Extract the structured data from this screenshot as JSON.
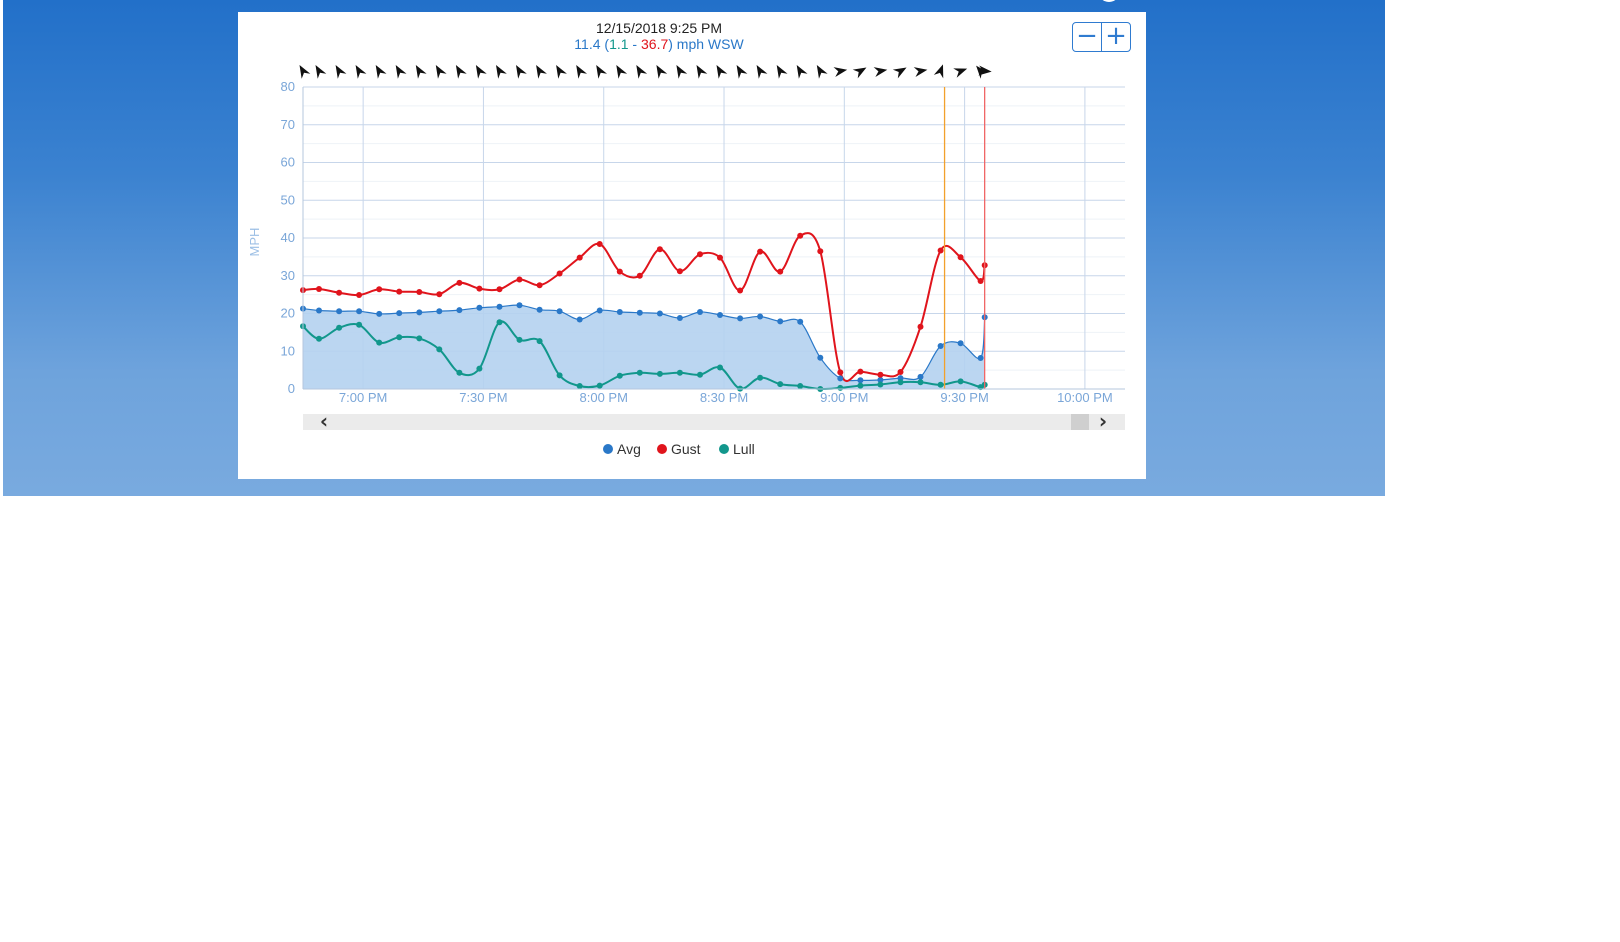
{
  "header": {
    "timestamp": "12/15/2018 9:25 PM",
    "avg_value": "11.4",
    "open_paren": " (",
    "lull_value": "1.1",
    "dash": " - ",
    "gust_value": "36.7",
    "close_unit": ") mph WSW"
  },
  "zoom": {
    "out_label": "−",
    "in_label": "+"
  },
  "colors": {
    "avg": "#2a78c8",
    "avg_fill": "#b4d1f0",
    "gust": "#e0141c",
    "lull": "#12978c",
    "grid": "#c7d6ea",
    "axis_text": "#7aa6d8",
    "cursor_line": "#f2a12c",
    "end_line": "#f06666"
  },
  "scrollbar": {
    "left_label": "‹",
    "right_label": "›"
  },
  "chart_data": {
    "type": "line",
    "ylabel": "MPH",
    "ylim": [
      0,
      80
    ],
    "yticks": [
      0,
      10,
      20,
      30,
      40,
      50,
      60,
      70,
      80
    ],
    "xlim": [
      "6:45 PM",
      "10:10 PM"
    ],
    "xticks": [
      "7:00 PM",
      "7:30 PM",
      "8:00 PM",
      "8:30 PM",
      "9:00 PM",
      "9:30 PM",
      "10:00 PM"
    ],
    "cursor_time": "9:25 PM",
    "end_time": "9:35 PM",
    "x": [
      "6:45 PM",
      "6:49 PM",
      "6:54 PM",
      "6:59 PM",
      "7:04 PM",
      "7:09 PM",
      "7:14 PM",
      "7:19 PM",
      "7:24 PM",
      "7:29 PM",
      "7:34 PM",
      "7:39 PM",
      "7:44 PM",
      "7:49 PM",
      "7:54 PM",
      "7:59 PM",
      "8:04 PM",
      "8:09 PM",
      "8:14 PM",
      "8:19 PM",
      "8:24 PM",
      "8:29 PM",
      "8:34 PM",
      "8:39 PM",
      "8:44 PM",
      "8:49 PM",
      "8:54 PM",
      "8:59 PM",
      "9:04 PM",
      "9:09 PM",
      "9:14 PM",
      "9:19 PM",
      "9:24 PM",
      "9:29 PM",
      "9:34 PM",
      "9:35 PM"
    ],
    "series": [
      {
        "name": "Avg",
        "values": [
          21.3,
          20.8,
          20.6,
          20.6,
          19.9,
          20.1,
          20.3,
          20.6,
          20.9,
          21.5,
          21.8,
          22.2,
          21.0,
          20.6,
          18.4,
          20.8,
          20.4,
          20.2,
          20.0,
          18.8,
          20.4,
          19.6,
          18.7,
          19.2,
          17.9,
          17.8,
          8.3,
          2.8,
          2.3,
          2.4,
          2.9,
          3.2,
          11.4,
          12.1,
          8.2,
          19.0
        ]
      },
      {
        "name": "Gust",
        "values": [
          26.2,
          26.5,
          25.5,
          24.9,
          26.4,
          25.8,
          25.7,
          25.1,
          28.1,
          26.6,
          26.4,
          29.0,
          27.5,
          30.6,
          34.8,
          38.4,
          31.1,
          30.0,
          37.0,
          31.2,
          35.7,
          34.8,
          26.1,
          36.4,
          31.1,
          40.6,
          36.5,
          4.4,
          4.6,
          3.8,
          4.5,
          16.5,
          36.7,
          34.9,
          28.6,
          32.8
        ]
      },
      {
        "name": "Lull",
        "values": [
          16.6,
          13.3,
          16.2,
          17.0,
          12.3,
          13.7,
          13.4,
          10.5,
          4.3,
          5.4,
          17.7,
          13.0,
          12.7,
          3.6,
          0.8,
          0.9,
          3.5,
          4.3,
          4.0,
          4.3,
          3.8,
          5.7,
          0.1,
          3.0,
          1.3,
          0.8,
          0.0,
          0.3,
          0.9,
          1.2,
          1.8,
          1.8,
          1.1,
          2.0,
          0.5,
          1.1
        ]
      }
    ],
    "legend": [
      "Avg",
      "Gust",
      "Lull"
    ],
    "legend_position": "bottom-center",
    "grid": true
  }
}
